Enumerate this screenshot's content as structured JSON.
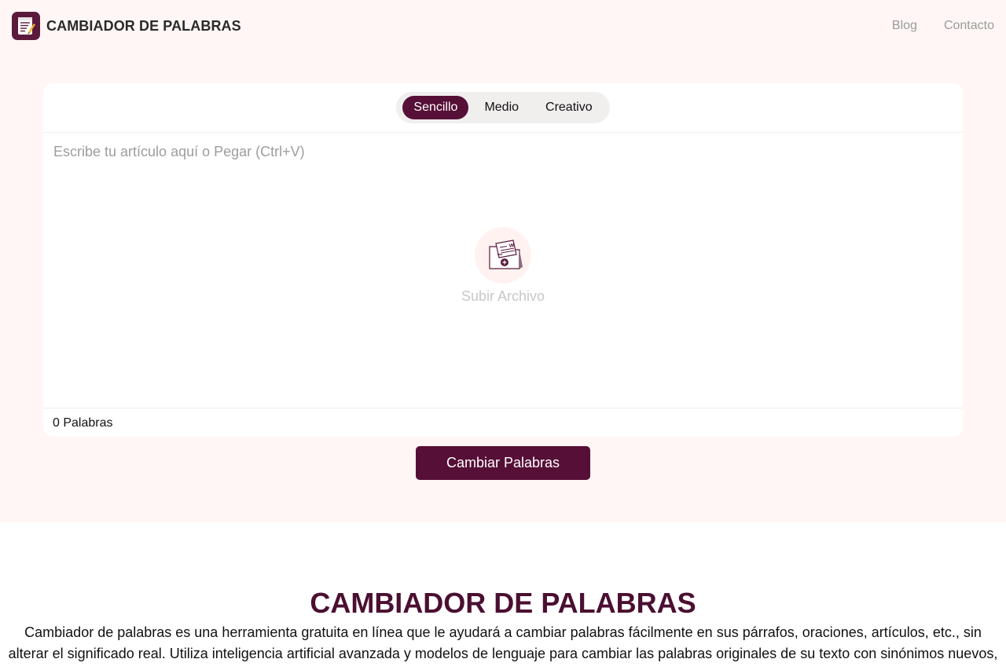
{
  "header": {
    "brand_name": "CAMBIADOR DE PALABRAS",
    "nav": [
      {
        "label": "Blog"
      },
      {
        "label": "Contacto"
      }
    ]
  },
  "modes": {
    "items": [
      {
        "label": "Sencillo",
        "active": true
      },
      {
        "label": "Medio",
        "active": false
      },
      {
        "label": "Creativo",
        "active": false
      }
    ]
  },
  "editor": {
    "placeholder": "Escribe tu artículo aquí o Pegar (Ctrl+V)",
    "value": "",
    "upload_label": "Subir Archivo",
    "word_count": "0 Palabras"
  },
  "actions": {
    "submit_label": "Cambiar Palabras"
  },
  "article": {
    "title": "CAMBIADOR DE PALABRAS",
    "intro": "Cambiador de palabras es una herramienta gratuita en línea que le ayudará a cambiar palabras fácilmente en sus párrafos, oraciones, artículos, etc., sin alterar el significado real. Utiliza inteligencia artificial avanzada y modelos de lenguaje para cambiar las palabras originales de su texto con sinónimos nuevos,"
  },
  "colors": {
    "brand": "#560f36",
    "hero_bg": "#fff6f5",
    "title": "#4b0f31"
  },
  "icons": {
    "logo": "notepad-pencil-icon",
    "upload": "folder-document-upload-icon"
  }
}
